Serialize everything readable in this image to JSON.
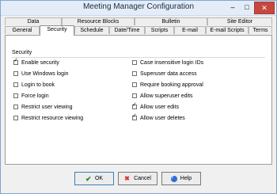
{
  "window": {
    "title": "Meeting Manager Configuration"
  },
  "tabs": {
    "row_back": [
      "Data",
      "Resource Blocks",
      "Bulletin",
      "Site Editor"
    ],
    "row_front": [
      "General",
      "Security",
      "Schedule",
      "Date/Time",
      "Scripts",
      "E-mail",
      "E-mail Scripts",
      "Terms"
    ],
    "active": "Security"
  },
  "security": {
    "group_label": "Security",
    "left": [
      {
        "label": "Enable security",
        "checked": true
      },
      {
        "label": "Use Windows login",
        "checked": false
      },
      {
        "label": "Login to book",
        "checked": false
      },
      {
        "label": "Force login",
        "checked": false
      },
      {
        "label": "Restrict user viewing",
        "checked": false
      },
      {
        "label": "Restrict resource viewing",
        "checked": false
      }
    ],
    "right": [
      {
        "label": "Case insensitive login IDs",
        "checked": false
      },
      {
        "label": "Superuser data access",
        "checked": false
      },
      {
        "label": "Require booking approval",
        "checked": false
      },
      {
        "label": "Allow superuser edits",
        "checked": false
      },
      {
        "label": "Allow user edits",
        "checked": true
      },
      {
        "label": "Allow user deletes",
        "checked": true
      }
    ]
  },
  "buttons": {
    "ok": "OK",
    "cancel": "Cancel",
    "help": "Help"
  },
  "colors": {
    "close_button": "#c7473f",
    "accent_border": "#3c7fb1"
  }
}
